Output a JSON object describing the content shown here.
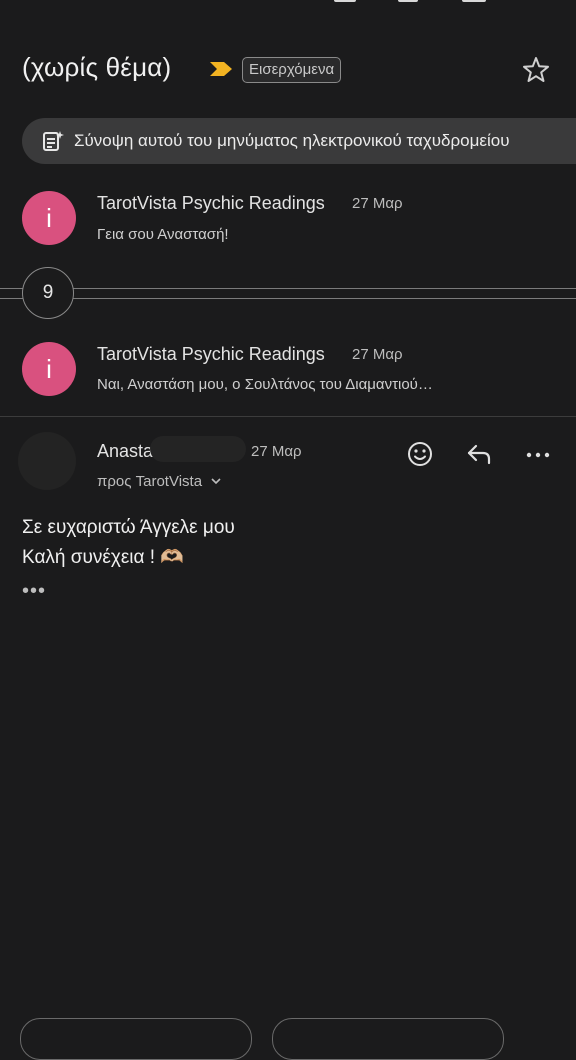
{
  "email": {
    "subject": "(χωρίς θέμα)",
    "label": "Εισερχόμενα",
    "summary_label": "Σύνοψη αυτού του μηνύματος ηλεκτρονικού ταχυδρομείου"
  },
  "messages": [
    {
      "avatar_letter": "i",
      "sender": "TarotVista Psychic Readings",
      "date": "27 Μαρ",
      "snippet": "Γεια σου Αναστασή!"
    },
    {
      "avatar_letter": "i",
      "sender": "TarotVista Psychic Readings",
      "date": "27 Μαρ",
      "snippet": "Ναι, Αναστάση μου, ο Σουλτάνος του Διαμαντιού…"
    }
  ],
  "collapsed_count": "9",
  "open_message": {
    "sender": "Anasta",
    "date": "27 Μαρ",
    "recipient_line": "προς TarotVista",
    "body_line1": "Σε ευχαριστώ Άγγελε μου",
    "body_line2": "Καλή συνέχεια ! 🫶🏼",
    "trimmed_content": "•••"
  },
  "colors": {
    "background": "#1b1b1c",
    "avatar_pink": "#d9517f",
    "importance_marker": "#f2b322",
    "pill": "#3a3a3b"
  },
  "icons": [
    "importance-marker-icon",
    "star-icon",
    "summary-doc-icon",
    "emoji-reaction-icon",
    "reply-icon",
    "more-vert-icon",
    "chevron-down-icon"
  ]
}
